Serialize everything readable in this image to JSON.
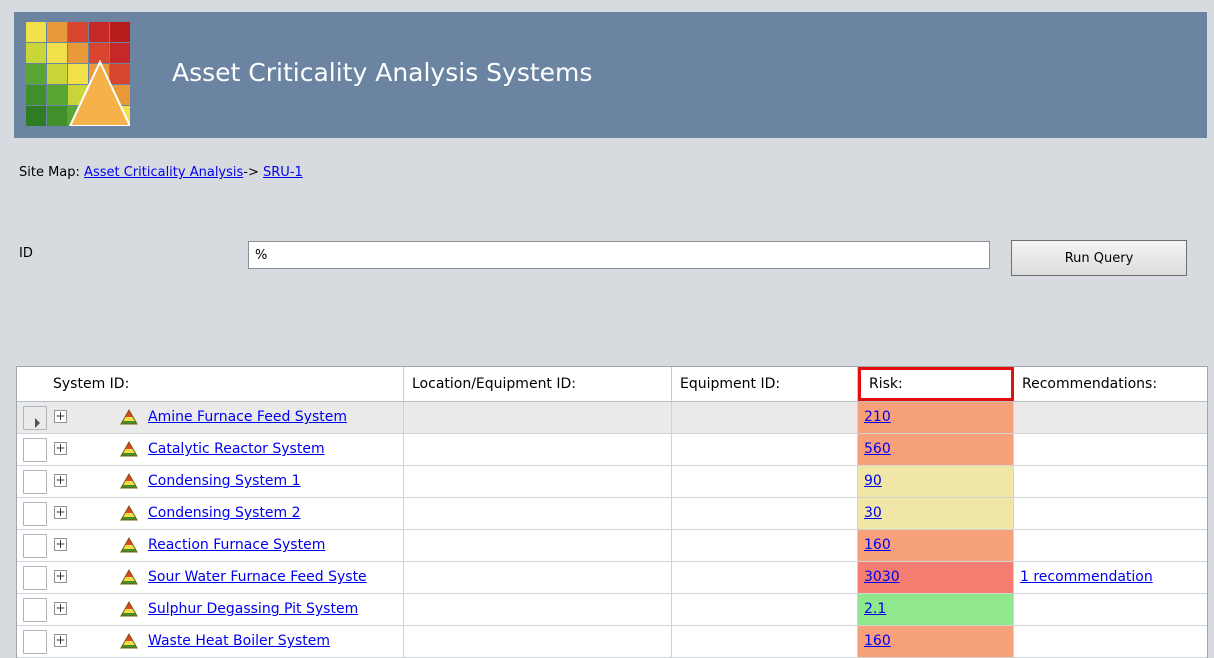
{
  "header": {
    "title": "Asset Criticality Analysis Systems"
  },
  "sitemap": {
    "label": "Site Map:",
    "links": [
      "Asset Criticality Analysis",
      "SRU-1"
    ],
    "separator": "->"
  },
  "query": {
    "id_label": "ID",
    "id_value": "%",
    "run_button": "Run Query"
  },
  "grid": {
    "columns": [
      "System ID:",
      "Location/Equipment ID:",
      "Equipment ID:",
      "Risk:",
      "Recommendations:"
    ],
    "rows": [
      {
        "system": "Amine Furnace Feed System",
        "location": "",
        "equipment": "",
        "risk": "210",
        "risk_color": "#f7a07c",
        "recommendation": "",
        "selected": true
      },
      {
        "system": "Catalytic Reactor System",
        "location": "",
        "equipment": "",
        "risk": "560",
        "risk_color": "#f7a07c",
        "recommendation": ""
      },
      {
        "system": "Condensing System 1",
        "location": "",
        "equipment": "",
        "risk": "90",
        "risk_color": "#f0e6a8",
        "recommendation": ""
      },
      {
        "system": "Condensing System 2",
        "location": "",
        "equipment": "",
        "risk": "30",
        "risk_color": "#f0e6a8",
        "recommendation": ""
      },
      {
        "system": "Reaction Furnace System",
        "location": "",
        "equipment": "",
        "risk": "160",
        "risk_color": "#f7a07c",
        "recommendation": ""
      },
      {
        "system": "Sour Water Furnace Feed Syste",
        "location": "",
        "equipment": "",
        "risk": "3030",
        "risk_color": "#f57e72",
        "recommendation": "1 recommendation"
      },
      {
        "system": "Sulphur Degassing Pit System",
        "location": "",
        "equipment": "",
        "risk": "2.1",
        "risk_color": "#8fe88c",
        "recommendation": ""
      },
      {
        "system": "Waste Heat Boiler System",
        "location": "",
        "equipment": "",
        "risk": "160",
        "risk_color": "#f7a07c",
        "recommendation": ""
      }
    ]
  },
  "colors": {
    "banner": "#6a84a2",
    "highlight": "#e01010",
    "link": "#0000ee"
  },
  "icons": {
    "logo": "risk-matrix-logo",
    "row_icon": "risk-triangle-icon",
    "expander": "plus-icon"
  }
}
